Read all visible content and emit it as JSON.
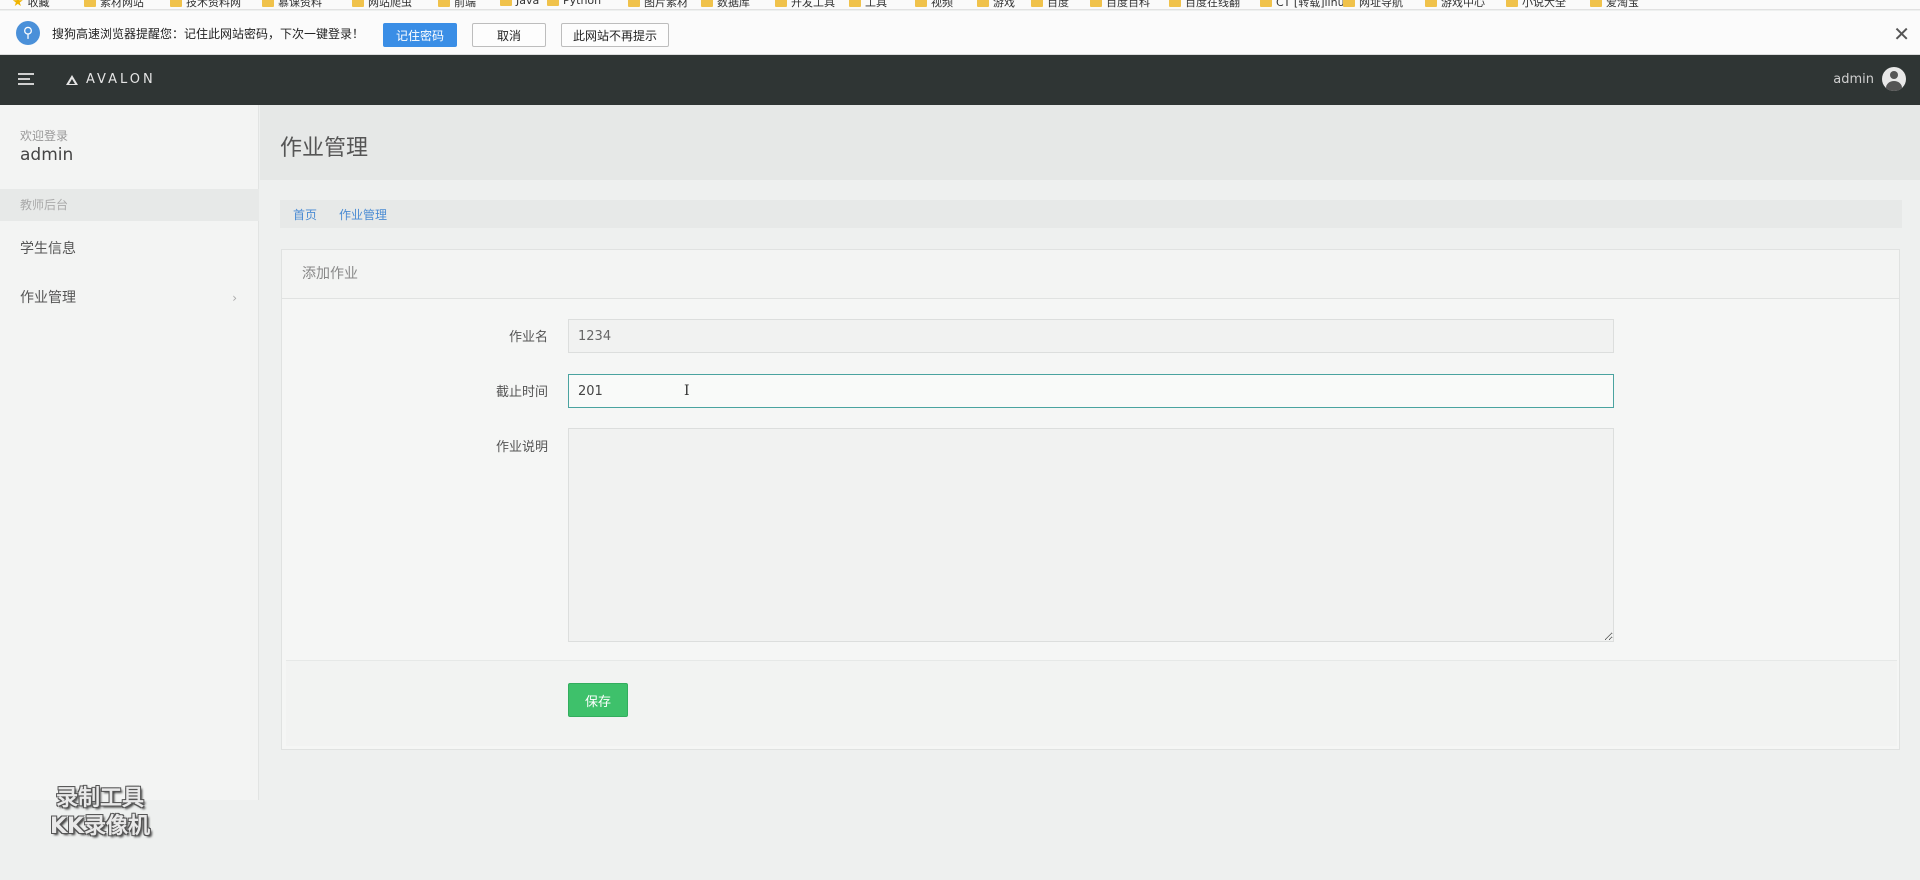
{
  "browser": {
    "bookmarks": [
      {
        "label": "收藏",
        "icon": "star-icon"
      },
      {
        "label": "素材网站",
        "icon": "folder-icon"
      },
      {
        "label": "技术资料网",
        "icon": "folder-icon"
      },
      {
        "label": "慕课资料",
        "icon": "folder-icon"
      },
      {
        "label": "网站爬虫",
        "icon": "folder-icon"
      },
      {
        "label": "前端",
        "icon": "folder-icon"
      },
      {
        "label": "Java",
        "icon": "folder-icon"
      },
      {
        "label": "Python",
        "icon": "folder-icon"
      },
      {
        "label": "图片素材",
        "icon": "folder-icon"
      },
      {
        "label": "数据库",
        "icon": "folder-icon"
      },
      {
        "label": "开发工具",
        "icon": "folder-icon"
      },
      {
        "label": "工具",
        "icon": "folder-icon"
      },
      {
        "label": "视频",
        "icon": "folder-icon"
      },
      {
        "label": "游戏",
        "icon": "folder-icon"
      },
      {
        "label": "百度",
        "icon": "paw-icon"
      },
      {
        "label": "百度百科",
        "icon": "paw-icon"
      },
      {
        "label": "百度在线翻",
        "icon": "translate-icon"
      },
      {
        "label": "CT [转载]linu",
        "icon": "page-icon"
      },
      {
        "label": "网址导航",
        "icon": "globe-icon"
      },
      {
        "label": "游戏中心",
        "icon": "game-icon"
      },
      {
        "label": "小说大全",
        "icon": "book-icon"
      },
      {
        "label": "爱淘宝",
        "icon": "page-icon"
      }
    ],
    "password_prompt": {
      "message": "搜狗高速浏览器提醒您：记住此网站密码，下次一键登录！",
      "remember_label": "记住密码",
      "cancel_label": "取消",
      "never_label": "此网站不再提示",
      "close_symbol": "✕"
    }
  },
  "navbar": {
    "brand": "AVALON",
    "user": "admin"
  },
  "sidebar": {
    "welcome_label": "欢迎登录",
    "username": "admin",
    "section_title": "教师后台",
    "items": [
      {
        "label": "学生信息"
      },
      {
        "label": "作业管理",
        "chevron": "›"
      }
    ]
  },
  "page": {
    "title": "作业管理",
    "breadcrumb": [
      "首页",
      "作业管理"
    ]
  },
  "form": {
    "panel_title": "添加作业",
    "name_label": "作业名",
    "name_value": "1234",
    "deadline_label": "截止时间",
    "deadline_value": "201",
    "desc_label": "作业说明",
    "desc_value": "",
    "save_label": "保存"
  },
  "watermark": {
    "line1": "录制工具",
    "line2": "KK录像机"
  },
  "colors": {
    "navbar_bg": "#2f3534",
    "save_button": "#3ec16b",
    "link": "#4a8bd3",
    "prompt_primary": "#3a8ee6"
  }
}
